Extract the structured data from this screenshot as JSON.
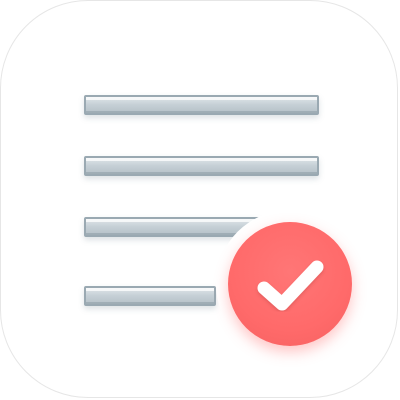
{
  "icon": {
    "name": "task-list-app-icon",
    "colors": {
      "background": "#ffffff",
      "line_fill": "#c7d1d7",
      "line_border": "#9aa9b2",
      "badge": "#ff6a6a",
      "check": "#ffffff"
    },
    "glyphs": {
      "badge_icon": "check-icon"
    }
  }
}
